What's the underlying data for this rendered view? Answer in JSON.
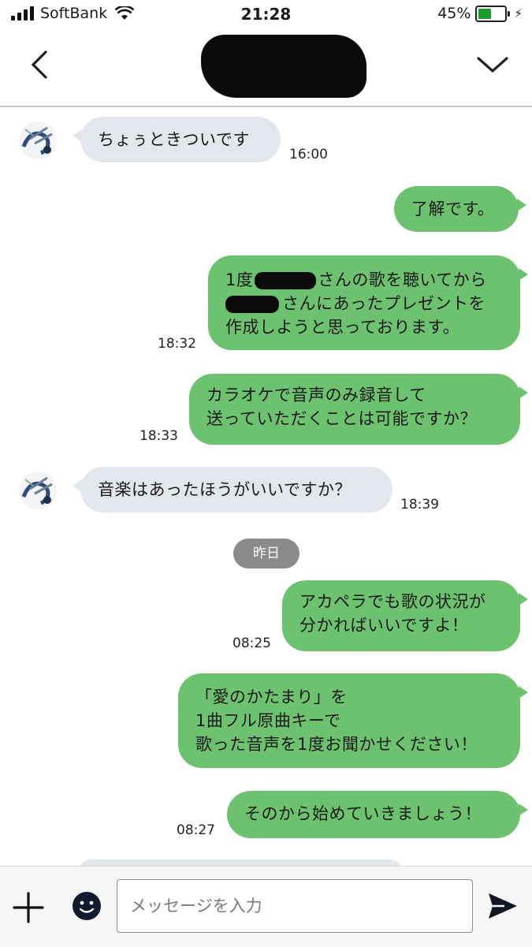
{
  "status": {
    "carrier": "SoftBank",
    "time": "21:28",
    "battery": "45%"
  },
  "messages": [
    {
      "text": "ちょぅときついです",
      "time": "16:00"
    },
    {
      "text": "了解です。"
    },
    {
      "line1": "1度",
      "line1b": "さんの歌を聴いてから",
      "line2": "さんにあったプレゼントを",
      "line3": "作成しようと思っております。",
      "time": "18:32"
    },
    {
      "line1": "カラオケで音声のみ録音して",
      "line2": "送っていただくことは可能ですか？",
      "time": "18:33"
    },
    {
      "text": "音楽はあったほうがいいですか？",
      "time": "18:39"
    },
    {
      "line1": "アカペラでも歌の状況が",
      "line2": "分かればいいですよ！",
      "time": "08:25"
    },
    {
      "line1": "「愛のかたまり」を",
      "line2": "1曲フル原曲キーで",
      "line3": "歌った音声を1度お聞かせください！"
    },
    {
      "text": "そのから始めていきましょう！",
      "time": "08:27"
    }
  ],
  "date_divider": "昨日",
  "composer": {
    "placeholder": "メッセージを入力"
  },
  "colors": {
    "outgoing": "#6cc26e",
    "incoming": "#e3e6ec",
    "divider_chip": "#8b8b8b"
  }
}
